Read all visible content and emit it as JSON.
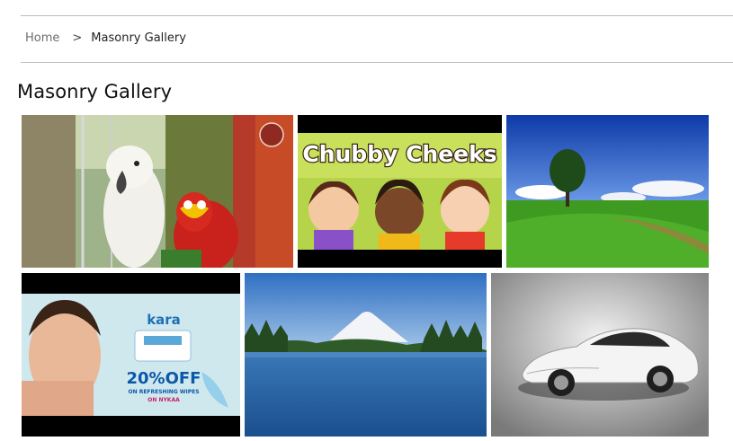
{
  "breadcrumb": {
    "home": "Home",
    "separator": ">",
    "current": "Masonry Gallery"
  },
  "page": {
    "title": "Masonry Gallery"
  },
  "gallery": {
    "items": [
      {
        "name": "cockatoo-parrot-photo"
      },
      {
        "name": "chubby-cheeks-thumbnail",
        "text": "Chubby Cheeks"
      },
      {
        "name": "green-field-tree-photo"
      },
      {
        "name": "kara-wipes-ad",
        "brand": "kara",
        "discount": "20%OFF",
        "tagline": "ON REFRESHING WIPES",
        "store": "ON NYKAA"
      },
      {
        "name": "mountain-lake-photo"
      },
      {
        "name": "white-sports-car-photo"
      }
    ]
  },
  "colors": {
    "rule": "#bdbdbd",
    "breadcrumb_home": "#6d6d6d"
  }
}
